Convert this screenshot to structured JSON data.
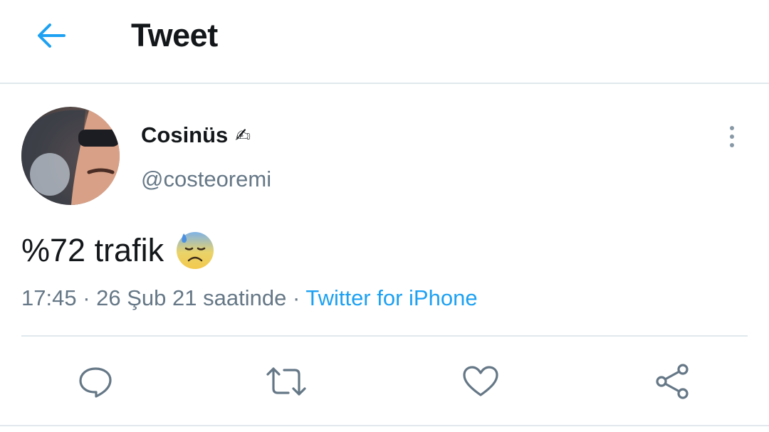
{
  "header": {
    "title": "Tweet",
    "back_icon": "arrow-left-icon"
  },
  "tweet": {
    "author": {
      "display_name": "Cosinüs",
      "name_emoji": "✍",
      "handle": "@costeoremi"
    },
    "text": "%72 trafik",
    "text_emoji": "anxious-face-with-sweat",
    "time": "17:45",
    "separator": "·",
    "date": "26 Şub 21 saatinde",
    "source": "Twitter for iPhone"
  },
  "actions": [
    {
      "icon": "reply-icon"
    },
    {
      "icon": "retweet-icon"
    },
    {
      "icon": "like-icon"
    },
    {
      "icon": "share-icon"
    }
  ],
  "colors": {
    "accent": "#1da1f2",
    "secondary_text": "#657786",
    "primary_text": "#14171a",
    "divider": "#e1e8ed"
  }
}
